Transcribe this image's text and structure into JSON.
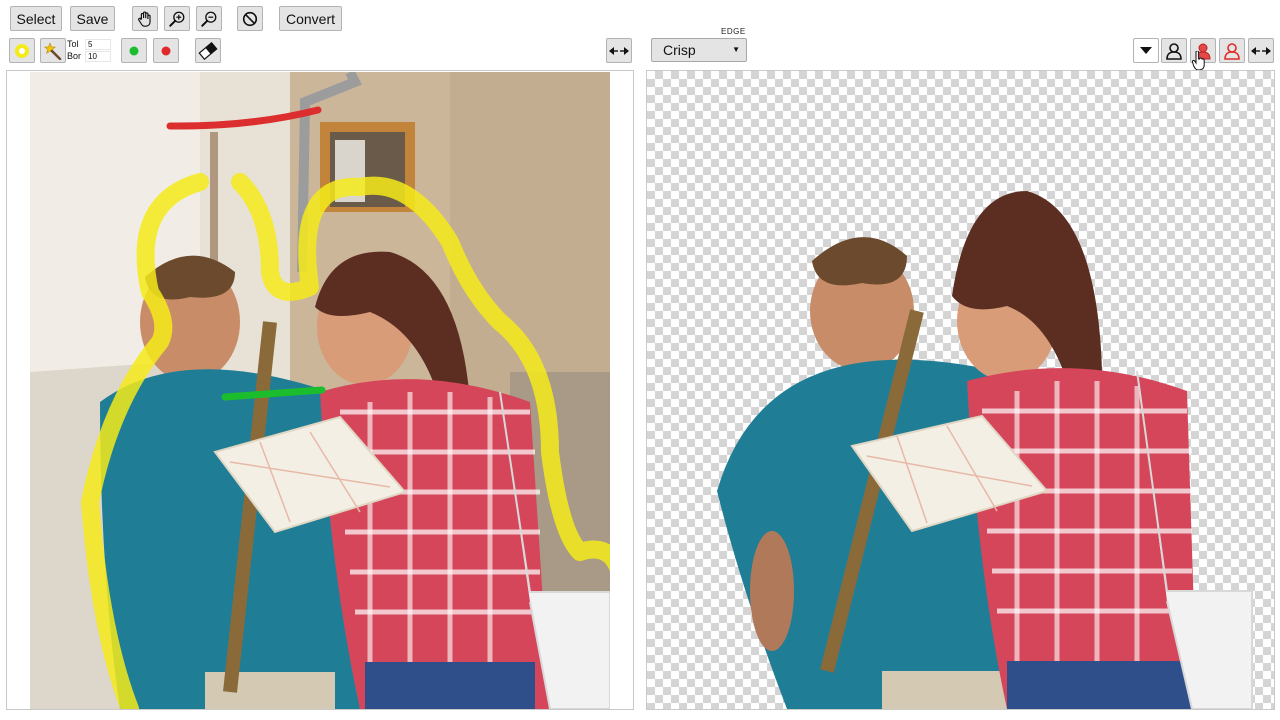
{
  "toolbar": {
    "select_label": "Select",
    "save_label": "Save",
    "convert_label": "Convert",
    "icons": [
      "hand-pan-icon",
      "zoom-in-icon",
      "zoom-out-icon",
      "cancel-icon"
    ]
  },
  "brush_tools": {
    "tol_label": "Tol",
    "tol_value": "5",
    "bor_label": "Bor",
    "bor_value": "10",
    "colors": {
      "highlight": "#f5ea1a",
      "keep": "#1cbd2c",
      "remove": "#e02a2a"
    }
  },
  "edge": {
    "label": "EDGE",
    "selected": "Crisp"
  },
  "preview_tools": {
    "icons": [
      "dropdown-icon",
      "person-outline-icon",
      "person-red-icon",
      "person-red-outline-icon",
      "swap-icon"
    ]
  }
}
